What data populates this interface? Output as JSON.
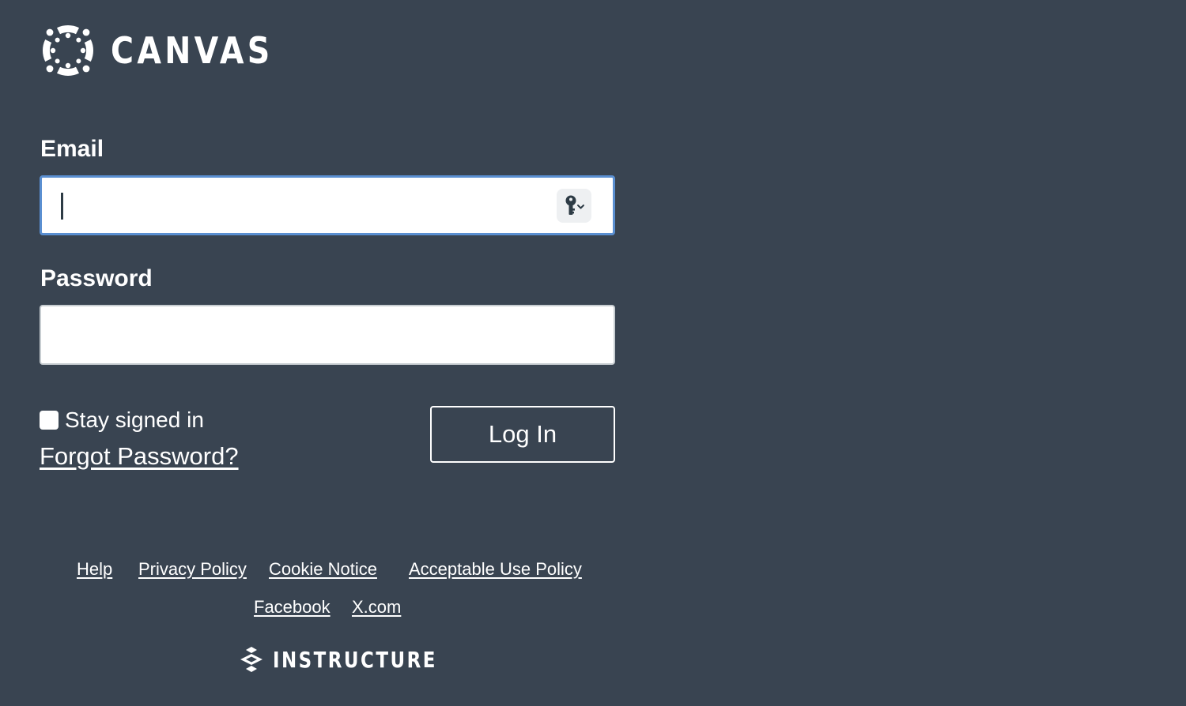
{
  "brand": {
    "name": "CANVAS",
    "logo_icon": "canvas-logo-icon"
  },
  "form": {
    "email_label": "Email",
    "email_value": "",
    "email_placeholder": "",
    "password_label": "Password",
    "password_value": "",
    "password_placeholder": "",
    "keychain_icon": "key-icon",
    "stay_signed_in_label": "Stay signed in",
    "stay_signed_in_checked": false,
    "forgot_password_label": "Forgot Password?",
    "login_label": "Log In"
  },
  "footer": {
    "links": [
      "Help",
      "Privacy Policy",
      "Cookie Notice",
      "Acceptable Use Policy"
    ],
    "social_links": [
      "Facebook",
      "X.com"
    ],
    "company": "INSTRUCTURE"
  },
  "colors": {
    "background": "#394451",
    "focus_ring": "#5a8fd1",
    "text": "#ffffff"
  }
}
